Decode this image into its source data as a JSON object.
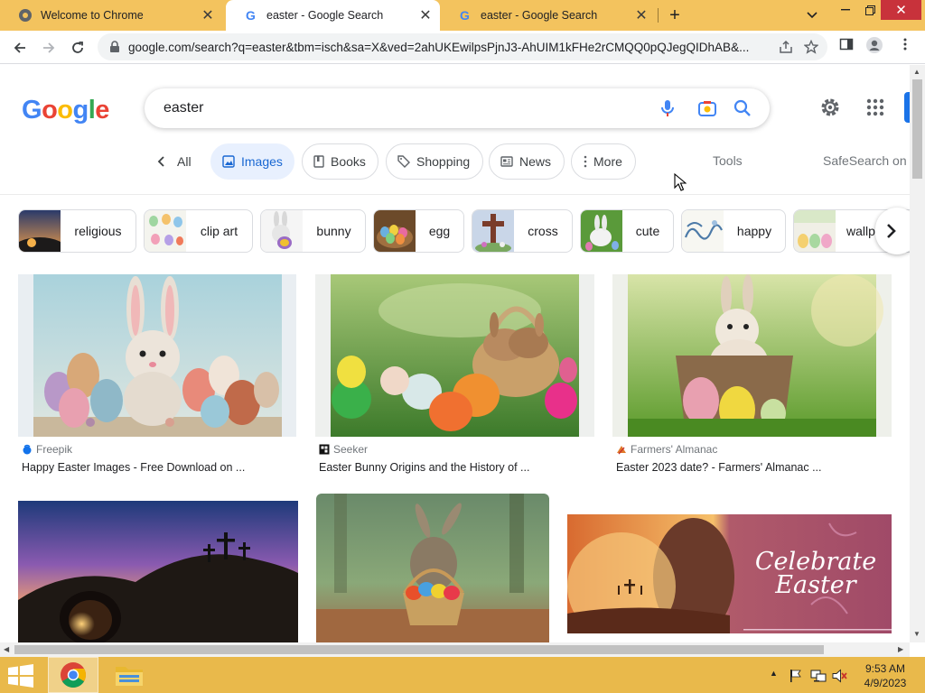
{
  "browser": {
    "tabs": [
      {
        "title": "Welcome to Chrome",
        "active": false
      },
      {
        "title": "easter - Google Search",
        "active": true
      },
      {
        "title": "easter - Google Search",
        "active": false
      }
    ],
    "new_tab": "+",
    "url": "google.com/search?q=easter&tbm=isch&sa=X&ved=2ahUKEwilpsPjnJ3-AhUIM1kFHe2rCMQQ0pQJegQIDhAB&..."
  },
  "google": {
    "logo": [
      "G",
      "o",
      "o",
      "g",
      "l",
      "e"
    ],
    "logo_colors": [
      "#4285f4",
      "#ea4335",
      "#fbbc05",
      "#4285f4",
      "#34a853",
      "#ea4335"
    ],
    "query": "easter",
    "filter_tabs": {
      "all": "All",
      "images": "Images",
      "books": "Books",
      "shopping": "Shopping",
      "news": "News",
      "more": "More",
      "tools": "Tools",
      "safesearch": "SafeSearch on"
    },
    "related_chips": [
      {
        "label": "religious"
      },
      {
        "label": "clip art"
      },
      {
        "label": "bunny"
      },
      {
        "label": "egg"
      },
      {
        "label": "cross"
      },
      {
        "label": "cute"
      },
      {
        "label": "happy"
      },
      {
        "label": "wallp"
      }
    ],
    "results": [
      {
        "source": "Freepik",
        "title": "Happy Easter Images - Free Download on ..."
      },
      {
        "source": "Seeker",
        "title": "Easter Bunny Origins and the History of ..."
      },
      {
        "source": "Farmers' Almanac",
        "title": "Easter 2023 date? - Farmers' Almanac ..."
      },
      {
        "overlay_line1": "Celebrate",
        "overlay_line2": "Easter"
      }
    ]
  },
  "taskbar": {
    "time": "9:53 AM",
    "date": "4/9/2023"
  },
  "colors": {
    "tabstrip": "#f3c35e",
    "taskbar": "#e9b94b",
    "accent_blue": "#1a73e8",
    "close_red": "#c8323b"
  }
}
